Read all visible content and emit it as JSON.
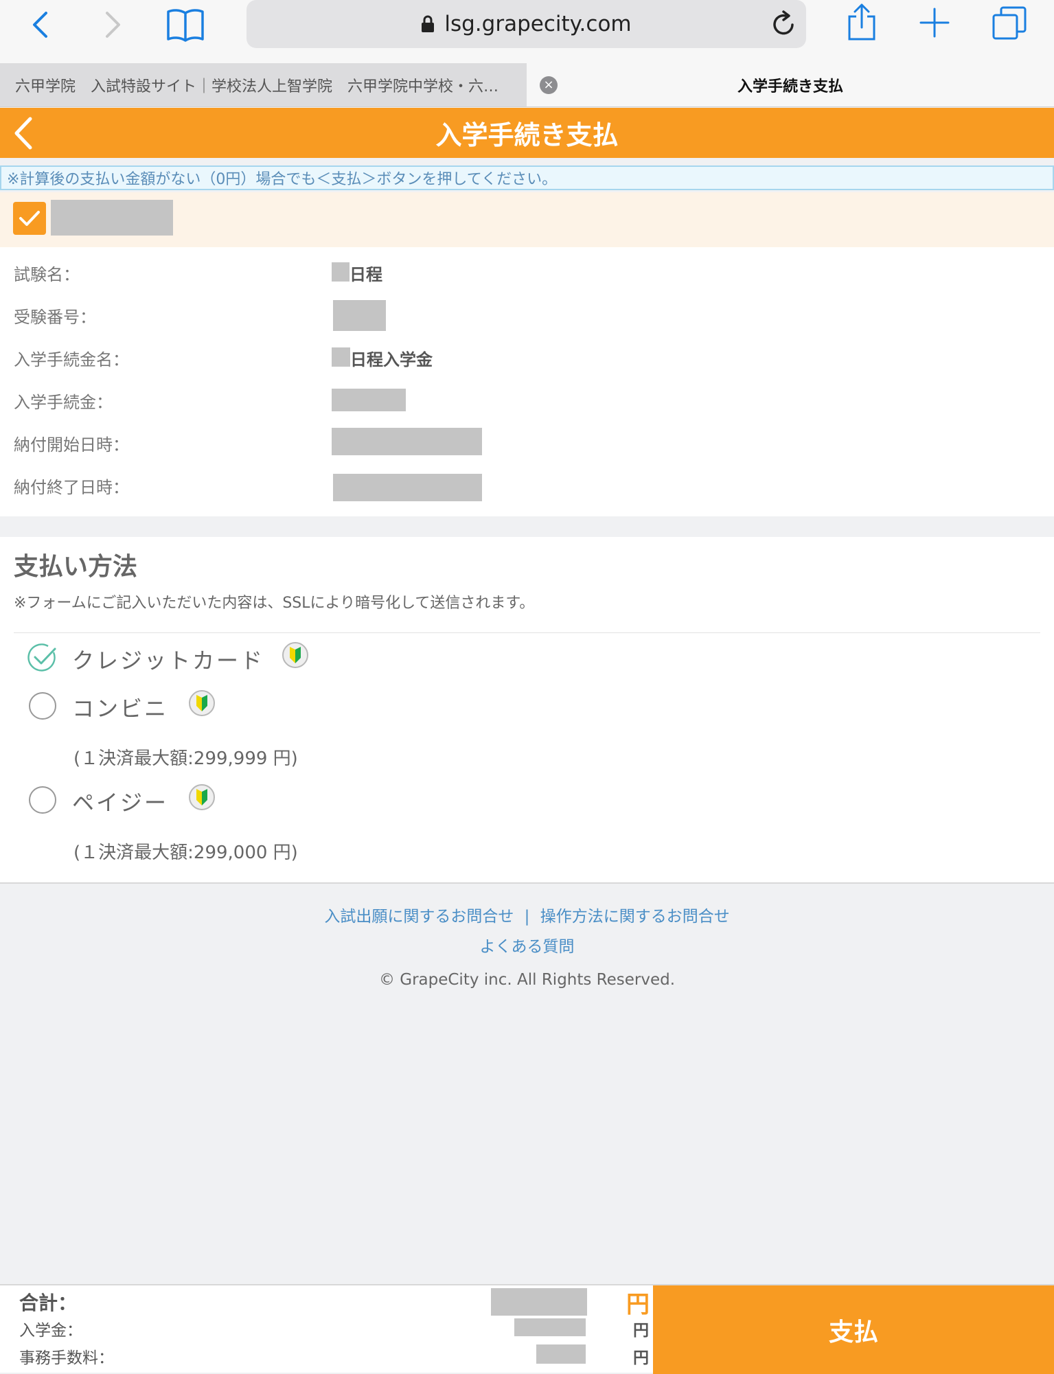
{
  "browser": {
    "url": "lsg.grapecity.com",
    "tabs": [
      {
        "label": "六甲学院　入試特設サイト｜学校法人上智学院　六甲学院中学校・六…",
        "active": false
      },
      {
        "label": "入学手続き支払",
        "active": true
      }
    ]
  },
  "header": {
    "title": "入学手続き支払"
  },
  "notice": "※計算後の支払い金額がない（0円）場合でも＜支払＞ボタンを押してください。",
  "details": {
    "exam_name_label": "試験名：",
    "exam_name_value": "日程",
    "exam_number_label": "受験番号：",
    "fee_name_label": "入学手続金名：",
    "fee_name_value": "日程入学金",
    "fee_label": "入学手続金：",
    "start_label": "納付開始日時：",
    "end_label": "納付終了日時："
  },
  "payment_method": {
    "title": "支払い方法",
    "ssl_note": "※フォームにご記入いただいた内容は、SSLにより暗号化して送信されます。",
    "options": [
      {
        "label": "クレジットカード",
        "selected": true
      },
      {
        "label": "コンビニ",
        "selected": false,
        "note": "(１決済最大額:299,999 円)"
      },
      {
        "label": "ペイジー",
        "selected": false,
        "note": "(１決済最大額:299,000 円)"
      }
    ]
  },
  "footer": {
    "link_exam": "入試出願に関するお問合せ",
    "separator": "|",
    "link_operation": "操作方法に関するお問合せ",
    "link_faq": "よくある質問",
    "copyright": "© GrapeCity inc. All Rights Reserved."
  },
  "summary": {
    "total_label": "合計：",
    "entrance_fee_label": "入学金：",
    "handling_fee_label": "事務手数料：",
    "yen": "円",
    "pay_button": "支払"
  },
  "colors": {
    "accent": "#f89b22",
    "link": "#4a8ec6",
    "check": "#5bbfa8"
  }
}
